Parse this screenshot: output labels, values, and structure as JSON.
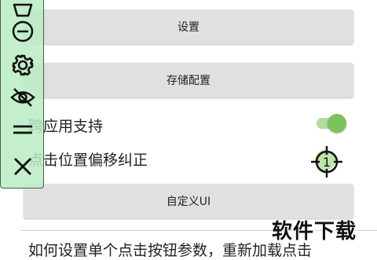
{
  "buttons": {
    "settings": "设置",
    "storage_config": "存储配置",
    "custom_ui": "自定义UI"
  },
  "rows": {
    "cross_app_support": "跨应用支持",
    "click_offset_correction": "点击位置偏移纠正"
  },
  "toggle": {
    "cross_app_enabled": true,
    "accent": "#7cc25b"
  },
  "target": {
    "number": "1"
  },
  "bottom_text": "如何设置单个点击按钮参数，重新加载点击",
  "watermark": "软件下载",
  "toolbar": {
    "icons": [
      "shield-icon",
      "minus-circle-icon",
      "gear-icon",
      "eye-off-icon",
      "drag-handle-icon",
      "close-icon"
    ],
    "background": "#b8ecc4"
  }
}
